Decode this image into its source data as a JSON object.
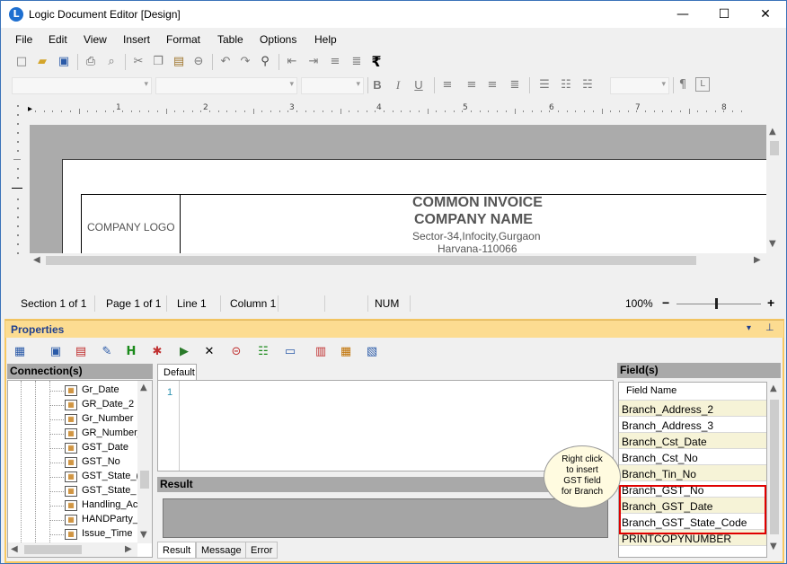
{
  "window": {
    "title": "Logic Document Editor [Design]",
    "icon_letter": "L",
    "minimize": "—",
    "maximize": "☐",
    "close": "✕"
  },
  "menu": [
    {
      "label": "File"
    },
    {
      "label": "Edit"
    },
    {
      "label": "View"
    },
    {
      "label": "Insert"
    },
    {
      "label": "Format"
    },
    {
      "label": "Table"
    },
    {
      "label": "Options"
    },
    {
      "label": "Help"
    }
  ],
  "toolbar": {
    "rupee_symbol": "₹",
    "pilcrow": "¶",
    "bold": "B",
    "italic": "I",
    "underline": "U"
  },
  "ruler": {
    "numbers": [
      "1",
      "2",
      "3",
      "4",
      "5",
      "6",
      "7",
      "8"
    ]
  },
  "document": {
    "company_logo": "COMPANY LOGO",
    "invoice_title": "COMMON INVOICE",
    "company_name": "COMPANY NAME",
    "address_line1": "Sector-34,Infocity,Gurgaon",
    "address_line2": "Harvana-110066"
  },
  "status": {
    "section": "Section 1 of 1",
    "page": "Page 1 of 1",
    "line": "Line 1",
    "column": "Column 1",
    "num": "NUM",
    "zoom": "100%",
    "zoom_minus": "−",
    "zoom_plus": "+"
  },
  "properties": {
    "title": "Properties",
    "pin": "⊥",
    "dropdown": "▾"
  },
  "connections": {
    "header": "Connection(s)",
    "items": [
      "Gr_Date",
      "GR_Date_2",
      "Gr_Number",
      "GR_Number_",
      "GST_Date",
      "GST_No",
      "GST_State_(",
      "GST_State_",
      "Handling_Ac",
      "HANDParty_",
      "Issue_Time"
    ]
  },
  "script": {
    "tab": "Default",
    "line_number": "1"
  },
  "result": {
    "header": "Result",
    "tabs": [
      "Result",
      "Message",
      "Error"
    ]
  },
  "fields": {
    "header": "Field(s)",
    "column_header": "Field Name",
    "items": [
      "Branch_Address_2",
      "Branch_Address_3",
      "Branch_Cst_Date",
      "Branch_Cst_No",
      "Branch_Tin_No",
      "Branch_GST_No",
      "Branch_GST_Date",
      "Branch_GST_State_Code",
      "PRINTCOPYNUMBER"
    ]
  },
  "callout": {
    "line1": "Right click",
    "line2": "to insert",
    "line3": "GST field",
    "line4": "for Branch"
  },
  "colors": {
    "accent": "#3b73b9",
    "properties_header": "#fcdc91",
    "highlight_box": "#e00000",
    "field_alt_row": "#f6f3d7"
  }
}
